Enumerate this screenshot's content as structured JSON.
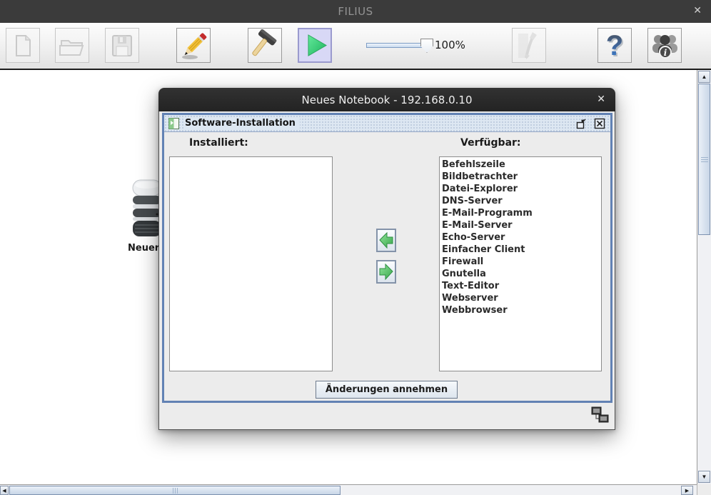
{
  "colors": {
    "accent_frame_blue": "#6282b4",
    "selected_tool_bg": "#d8d8f6",
    "play_green": "#2ecc71",
    "arrow_green": "#4fbe5d",
    "titlebar_dark": "#3b3b3b"
  },
  "app": {
    "title": "FILIUS",
    "close_glyph": "✕"
  },
  "toolbar": {
    "zoom_label": "100%",
    "glyphs": {
      "scroll_up": "▲",
      "scroll_down": "▼",
      "scroll_left": "◀",
      "scroll_right": "▶"
    },
    "buttons": [
      {
        "icon": "new-document-icon",
        "enabled": false
      },
      {
        "icon": "open-folder-icon",
        "enabled": false
      },
      {
        "icon": "save-icon",
        "enabled": false
      },
      {
        "icon": "pencil-design-mode-icon",
        "enabled": true
      },
      {
        "icon": "hammer-action-mode-icon",
        "enabled": true
      },
      {
        "icon": "play-simulation-mode-icon",
        "enabled": true,
        "selected": true
      },
      {
        "icon": "documentation-tool-icon",
        "enabled": false
      },
      {
        "icon": "help-question-icon",
        "enabled": true
      },
      {
        "icon": "community-info-icon",
        "enabled": true
      }
    ]
  },
  "workspace": {
    "node_label": "Neuer"
  },
  "dialog": {
    "title": "Neues Notebook - 192.168.0.10",
    "close_glyph": "✕",
    "frame": {
      "title": "Software-Installation",
      "installed_label": "Installiert:",
      "available_label": "Verfügbar:",
      "installed_items": [],
      "available_items": [
        "Befehlszeile",
        "Bildbetrachter",
        "Datei-Explorer",
        "DNS-Server",
        "E-Mail-Programm",
        "E-Mail-Server",
        "Echo-Server",
        "Einfacher Client",
        "Firewall",
        "Gnutella",
        "Text-Editor",
        "Webserver",
        "Webbrowser"
      ],
      "apply_label": "Änderungen annehmen"
    }
  }
}
